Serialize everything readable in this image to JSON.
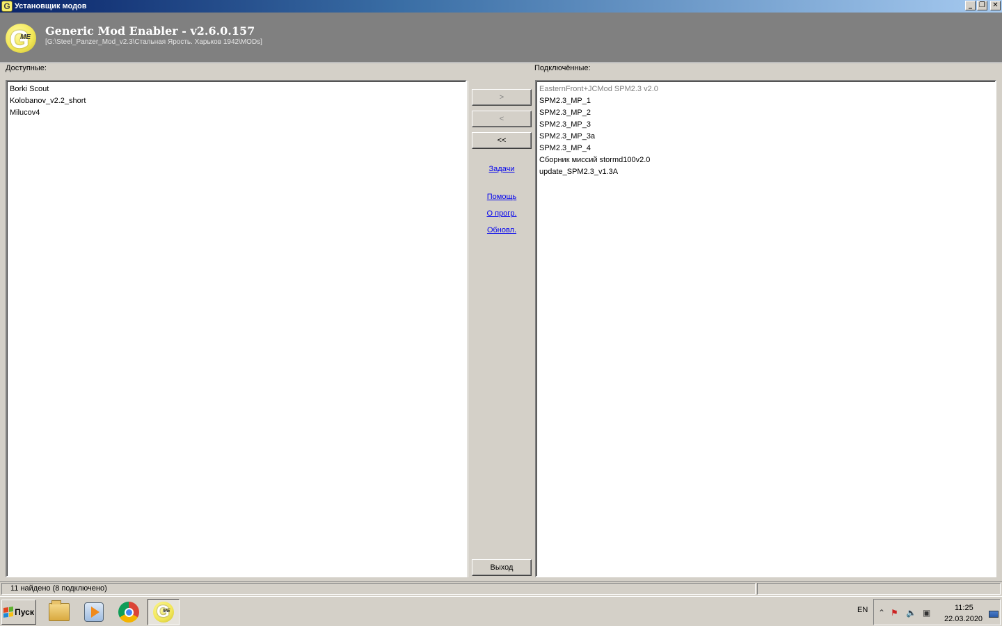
{
  "window": {
    "title": "Установщик модов",
    "icon": "gme-app-icon",
    "controls": {
      "minimize": "_",
      "restore": "❐",
      "close": "✕"
    }
  },
  "header": {
    "app_name": "Generic Mod Enabler - v2.6.0.157",
    "path": "[G:\\Steel_Panzer_Mod_v2.3\\Стальная Ярость. Харьков 1942\\MODs]",
    "logo": {
      "letter": "G",
      "sub": "ME"
    },
    "background_color": "#808080"
  },
  "available": {
    "label": "Доступные:",
    "items": [
      "Borki Scout",
      "Kolobanov_v2.2_short",
      "Milucov4"
    ]
  },
  "installed": {
    "label": "Подключённые:",
    "items": [
      {
        "text": "EasternFront+JCMod SPM2.3 v2.0",
        "greyed": true
      },
      {
        "text": "SPM2.3_MP_1",
        "greyed": false
      },
      {
        "text": "SPM2.3_MP_2",
        "greyed": false
      },
      {
        "text": "SPM2.3_MP_3",
        "greyed": false
      },
      {
        "text": "SPM2.3_MP_3a",
        "greyed": false
      },
      {
        "text": "SPM2.3_MP_4",
        "greyed": false
      },
      {
        "text": "Сборник миссий stormd100v2.0",
        "greyed": false
      },
      {
        "text": "update_SPM2.3_v1.3A",
        "greyed": false
      }
    ]
  },
  "middle": {
    "activate_label": ">",
    "deactivate_label": "<",
    "deactivate_all_label": "<<",
    "tasks_link": "Задачи",
    "help_link": "Помощь",
    "about_link": "О прогр.",
    "update_link": "Обновл.",
    "exit_label": "Выход"
  },
  "status": {
    "text": "11 найдено  (8 подключено)"
  },
  "taskbar": {
    "start_label": "Пуск",
    "apps": [
      "folder-icon",
      "media-player-icon",
      "chrome-icon",
      "gme-icon"
    ],
    "language": "EN",
    "time": "11:25",
    "date": "22.03.2020"
  }
}
